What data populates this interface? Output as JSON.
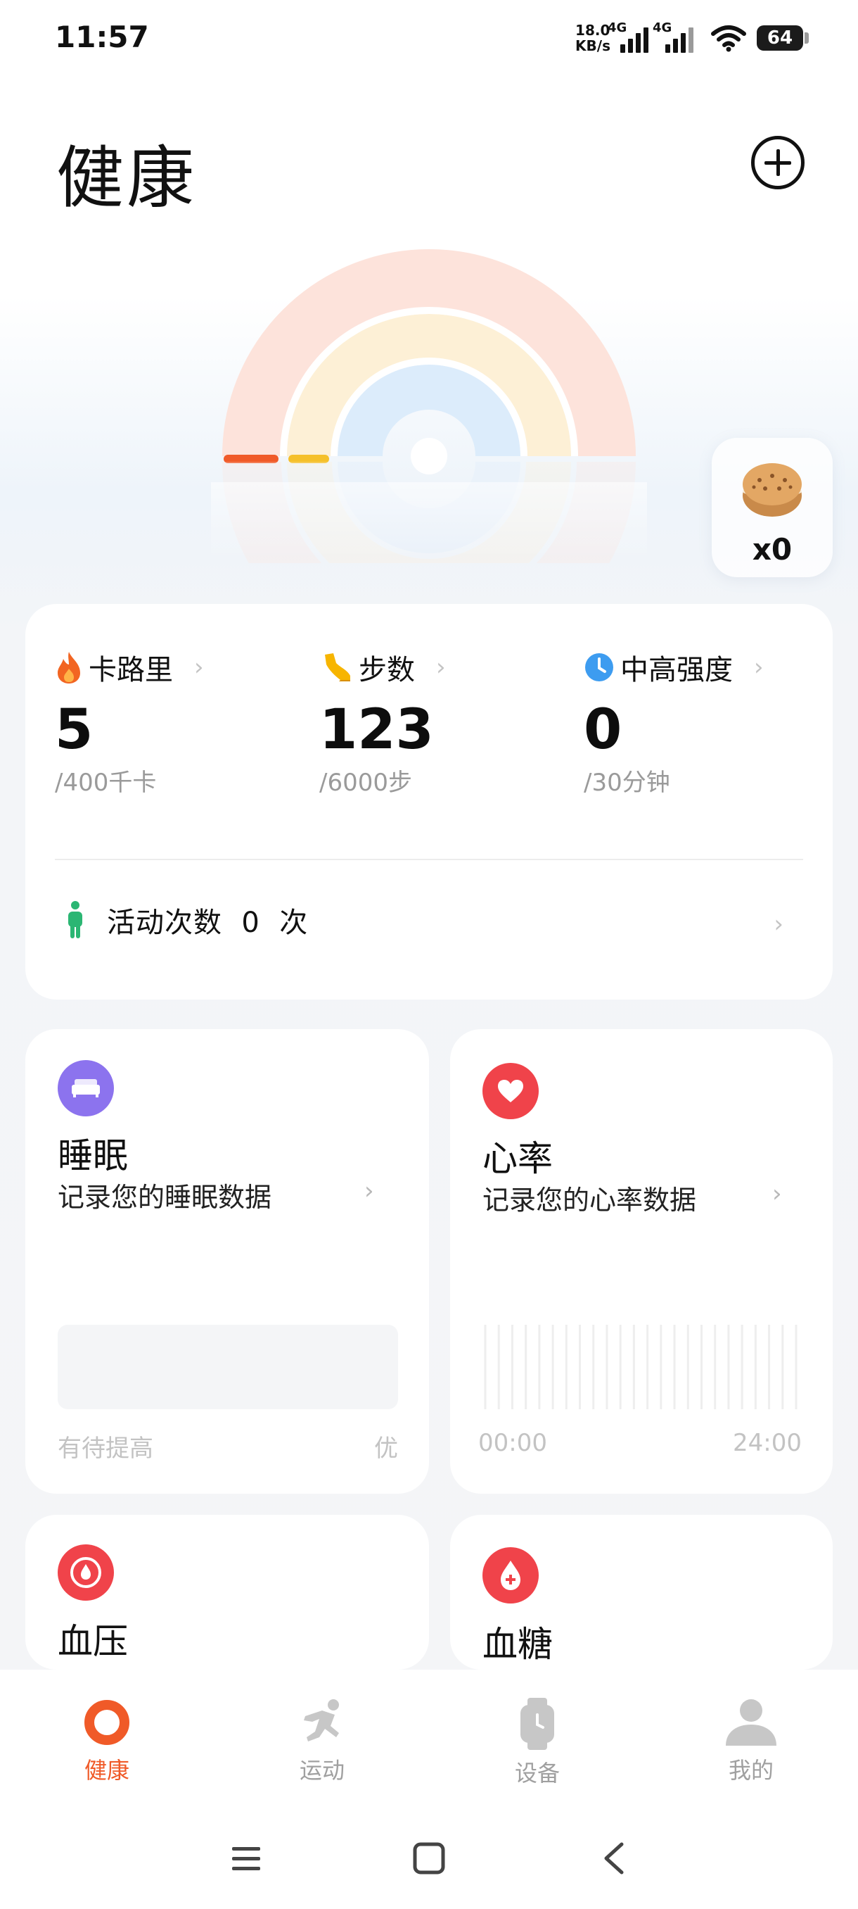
{
  "status_bar": {
    "time": "11:57",
    "net_speed_value": "18.0",
    "net_speed_unit": "KB/s",
    "sim1": "4G",
    "sim2": "4G",
    "battery": "64"
  },
  "header": {
    "title": "健康"
  },
  "cookie_badge": {
    "count": "x0"
  },
  "activity": {
    "calories": {
      "label": "卡路里",
      "value": "5",
      "goal": "/400千卡"
    },
    "steps": {
      "label": "步数",
      "value": "123",
      "goal": "/6000步"
    },
    "intensity": {
      "label": "中高强度",
      "value": "0",
      "goal": "/30分钟"
    },
    "count_label": "活动次数  0  次",
    "ring_progress": {
      "calories": 0.0125,
      "steps": 0.0205,
      "intensity": 0
    }
  },
  "sleep": {
    "title": "睡眠",
    "subtitle": "记录您的睡眠数据",
    "scale_low": "有待提高",
    "scale_high": "优"
  },
  "heart_rate": {
    "title": "心率",
    "subtitle": "记录您的心率数据",
    "time_start": "00:00",
    "time_end": "24:00"
  },
  "blood_pressure": {
    "title": "血压"
  },
  "blood_glucose": {
    "title": "血糖"
  },
  "nav": {
    "health": "健康",
    "sport": "运动",
    "device": "设备",
    "me": "我的"
  },
  "colors": {
    "accent": "#f05a28",
    "calorie_ring": "#fde3db",
    "step_ring": "#fdf0d6",
    "intensity_ring": "#dcecfb",
    "sleep_icon_bg": "#8c73ee",
    "heart_icon_bg": "#f0434a"
  }
}
